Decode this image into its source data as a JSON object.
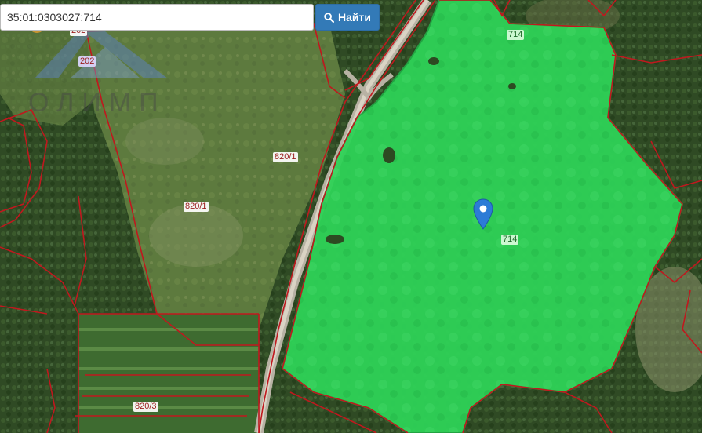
{
  "search": {
    "value": "35:01:0303027:714",
    "button_label": "Найти"
  },
  "logo": {
    "text": "ОЛИМП"
  },
  "labels": {
    "l202_top": "202",
    "l202": "202",
    "l820_1_a": "820/1",
    "l820_1_b": "820/1",
    "l820_3": "820/3",
    "l714_top": "714",
    "l714_center": "714"
  },
  "colors": {
    "selected_parcel": "#22d24a",
    "parcel_border": "#c0181e",
    "search_button": "#337ab7"
  },
  "icons": {
    "search_button": "search-icon",
    "marker": "map-marker-icon"
  }
}
